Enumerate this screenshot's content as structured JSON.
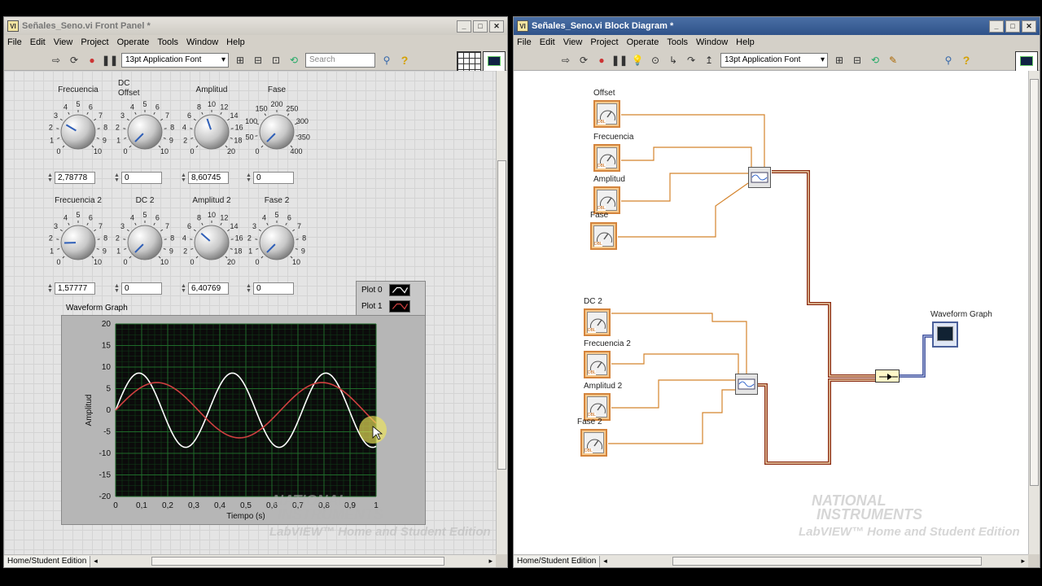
{
  "front_panel": {
    "title": "Señales_Seno.vi Front Panel *",
    "menu": [
      "File",
      "Edit",
      "View",
      "Project",
      "Operate",
      "Tools",
      "Window",
      "Help"
    ],
    "font_select": "13pt Application Font",
    "search_placeholder": "Search",
    "controls": [
      {
        "label": "Frecuencia",
        "value": "2,78778",
        "ticks": [
          "0",
          "1",
          "2",
          "3",
          "4",
          "5",
          "6",
          "7",
          "8",
          "9",
          "10"
        ],
        "pointer": 0.28
      },
      {
        "label": "DC Offset",
        "value": "0",
        "ticks": [
          "0",
          "1",
          "2",
          "3",
          "4",
          "5",
          "6",
          "7",
          "8",
          "9",
          "10"
        ],
        "pointer": 0.0
      },
      {
        "label": "Amplitud",
        "value": "8,60745",
        "ticks": [
          "0",
          "2",
          "4",
          "6",
          "8",
          "10",
          "12",
          "14",
          "16",
          "18",
          "20"
        ],
        "pointer": 0.43
      },
      {
        "label": "Fase",
        "value": "0",
        "ticks": [
          "0",
          "50",
          "100",
          "150",
          "200",
          "250",
          "300",
          "350",
          "400"
        ],
        "pointer": 0.0
      },
      {
        "label": "Frecuencia 2",
        "value": "1,57777",
        "ticks": [
          "0",
          "1",
          "2",
          "3",
          "4",
          "5",
          "6",
          "7",
          "8",
          "9",
          "10"
        ],
        "pointer": 0.16
      },
      {
        "label": "DC 2",
        "value": "0",
        "ticks": [
          "0",
          "1",
          "2",
          "3",
          "4",
          "5",
          "6",
          "7",
          "8",
          "9",
          "10"
        ],
        "pointer": 0.0
      },
      {
        "label": "Amplitud 2",
        "value": "6,40769",
        "ticks": [
          "0",
          "2",
          "4",
          "6",
          "8",
          "10",
          "12",
          "14",
          "16",
          "18",
          "20"
        ],
        "pointer": 0.32
      },
      {
        "label": "Fase 2",
        "value": "0",
        "ticks": [
          "0",
          "1",
          "2",
          "3",
          "4",
          "5",
          "6",
          "7",
          "8",
          "9",
          "10"
        ],
        "pointer": 0.0
      }
    ],
    "status": "Home/Student Edition",
    "watermark_line1": "NATIONAL",
    "watermark_line2": "INSTRUMENTS",
    "watermark_line3": "LabVIEW™ Home and Student Edition"
  },
  "block_diagram": {
    "title": "Señales_Seno.vi Block Diagram *",
    "menu": [
      "File",
      "Edit",
      "View",
      "Project",
      "Operate",
      "Tools",
      "Window",
      "Help"
    ],
    "font_select": "13pt Application Font",
    "terminals": [
      "Offset",
      "Frecuencia",
      "Amplitud",
      "Fase",
      "DC 2",
      "Frecuencia 2",
      "Amplitud 2",
      "Fase 2"
    ],
    "terminal_type": "DBL",
    "graph_label": "Waveform Graph",
    "status": "Home/Student Edition"
  },
  "chart_data": {
    "type": "line",
    "title": "Waveform Graph",
    "xlabel": "Tiempo (s)",
    "ylabel": "Amplitud",
    "xlim": [
      0,
      1
    ],
    "ylim": [
      -20,
      20
    ],
    "x_ticks": [
      "0",
      "0,1",
      "0,2",
      "0,3",
      "0,4",
      "0,5",
      "0,6",
      "0,7",
      "0,8",
      "0,9",
      "1"
    ],
    "y_ticks": [
      "20",
      "15",
      "10",
      "5",
      "0",
      "-5",
      "-10",
      "-15",
      "-20"
    ],
    "grid": true,
    "series": [
      {
        "name": "Plot 0",
        "color": "#ffffff",
        "amplitude": 8.60745,
        "frequency": 2.78778,
        "offset": 0,
        "phase": 0
      },
      {
        "name": "Plot 1",
        "color": "#d04040",
        "amplitude": 6.40769,
        "frequency": 1.57777,
        "offset": 0,
        "phase": 0
      }
    ]
  }
}
